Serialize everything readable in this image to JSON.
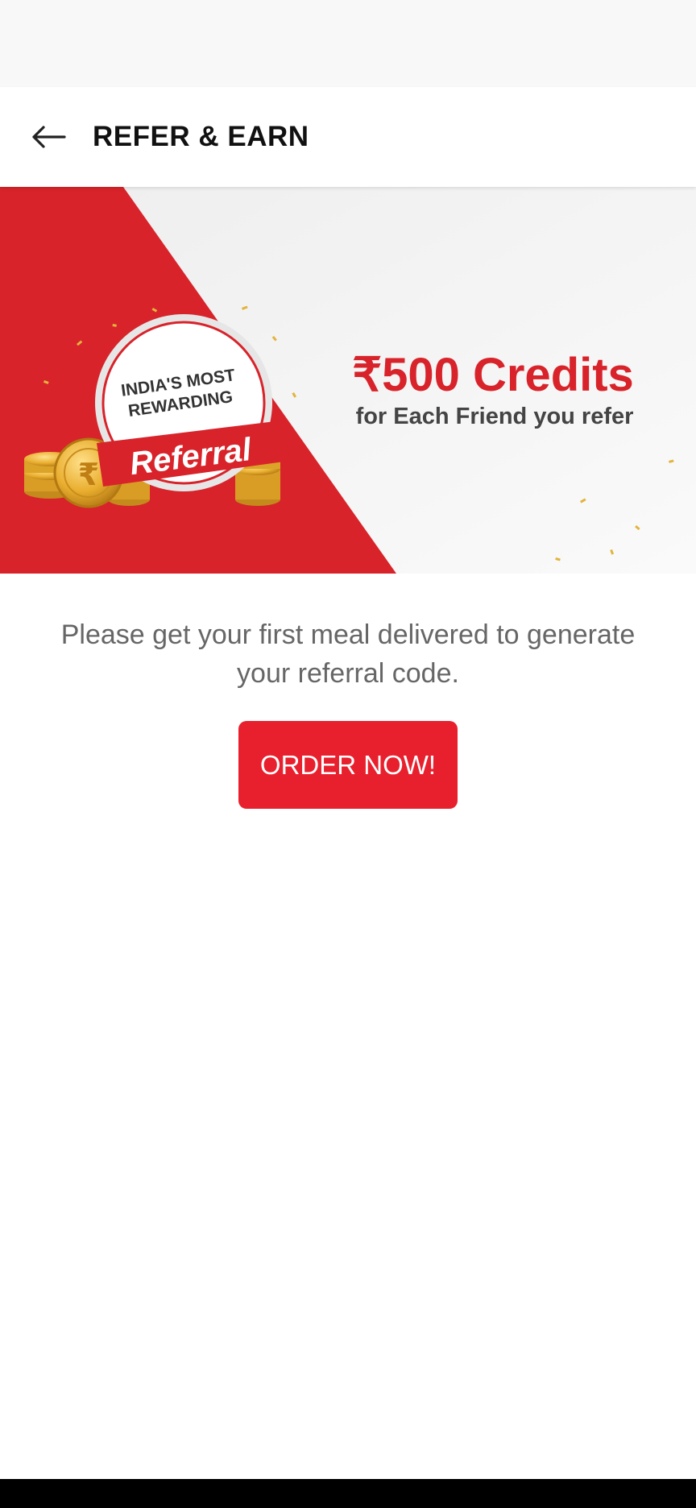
{
  "header": {
    "title": "REFER & EARN",
    "back_icon": "arrow-left-icon"
  },
  "banner": {
    "badge_line1": "INDIA'S MOST",
    "badge_line2": "REWARDING",
    "badge_ribbon": "Referral",
    "headline": "₹500 Credits",
    "subline": "for Each Friend you refer",
    "accent_color": "#d8232a"
  },
  "main": {
    "message_line1": "Please get your first meal delivered to generate",
    "message_line2": "your referral code.",
    "order_button_label": "ORDER NOW!",
    "button_color": "#e8202d"
  }
}
